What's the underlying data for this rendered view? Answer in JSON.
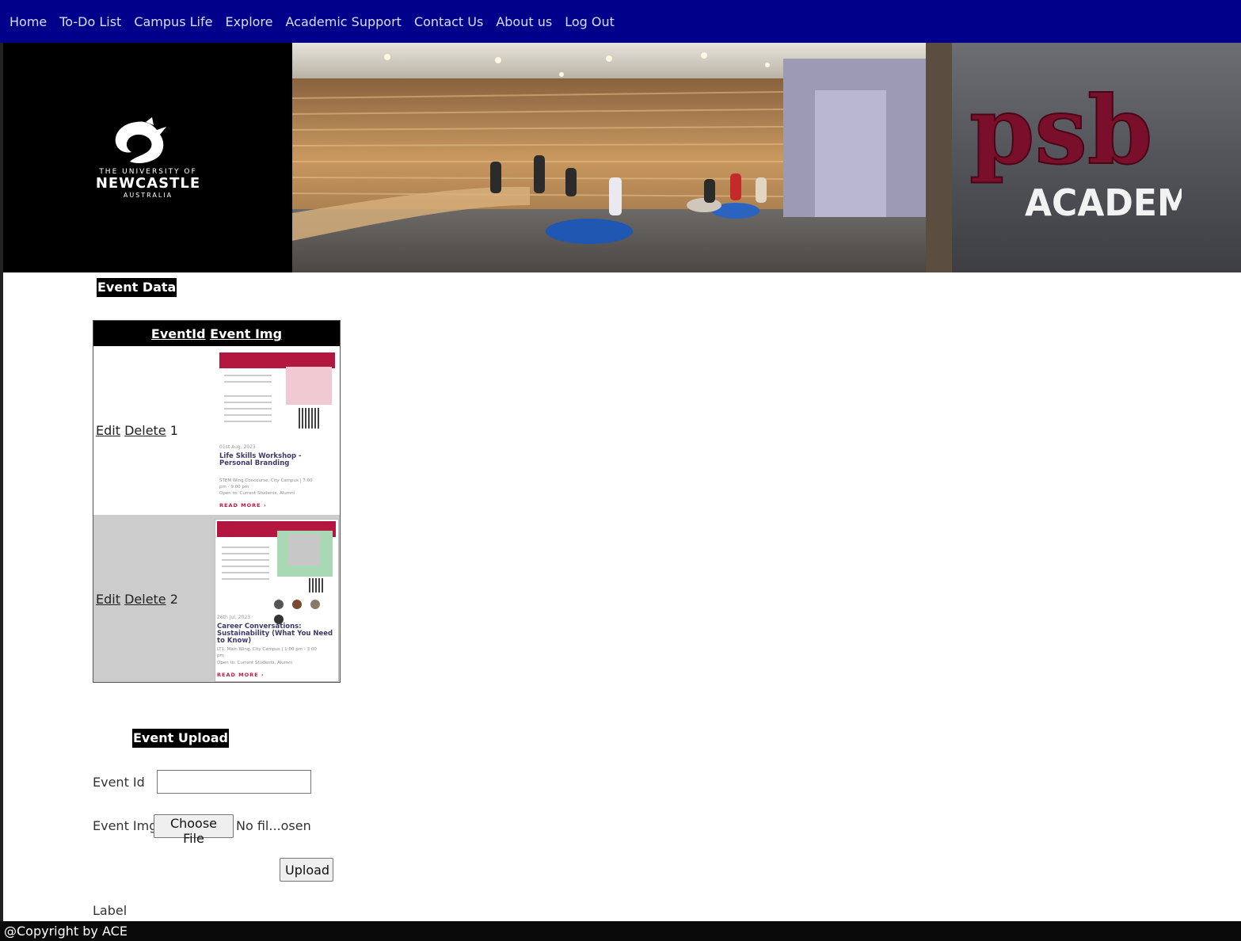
{
  "nav": {
    "items": [
      "Home",
      "To-Do List",
      "Campus Life",
      "Explore",
      "Academic Support",
      "Contact Us",
      "About us",
      "Log Out"
    ]
  },
  "banner": {
    "uon": {
      "line1": "THE UNIVERSITY OF",
      "line2": "NEWCASTLE",
      "line3": "AUSTRALIA"
    },
    "psb": {
      "line1": "psb",
      "line2": "ACADEMY"
    }
  },
  "event_data": {
    "heading": "Event Data",
    "columns": [
      "EventId",
      "Event Img"
    ],
    "rows": [
      {
        "edit": "Edit",
        "delete": "Delete",
        "id": "1",
        "poster": {
          "date": "01st Aug, 2023",
          "title_1": "Life Skills Workshop -",
          "title_2": "Personal Branding",
          "meta_1": "STEM Wing Concourse, City Campus | 7:00",
          "meta_2": "pm - 9:00 pm",
          "meta_3": "Open to: Current Students, Alumni",
          "more": "READ MORE ›"
        }
      },
      {
        "edit": "Edit",
        "delete": "Delete",
        "id": "2",
        "poster": {
          "date": "26th Jul, 2023",
          "title_1": "Career Conversations:",
          "title_2": "Sustainability (What You Need",
          "title_3": "to Know)",
          "meta_1": "LT1, Main Wing, City Campus | 1:00 pm - 3:00",
          "meta_2": "pm",
          "meta_3": "Open to: Current Students, Alumni",
          "more": "READ MORE ›"
        }
      }
    ]
  },
  "upload": {
    "heading": "Event Upload",
    "event_id_label": "Event Id",
    "event_id_value": "",
    "event_img_label": "Event Img",
    "choose_file": "Choose File",
    "file_status": "No fil...osen",
    "upload_button": "Upload",
    "label_text": "Label"
  },
  "footer": {
    "text": "@Copyright by ACE"
  },
  "colors": {
    "nav_bg": "#00008b",
    "nav_text": "#d9ddff",
    "footer_bg": "#0a0a0a",
    "poster_accent": "#b3163f"
  }
}
